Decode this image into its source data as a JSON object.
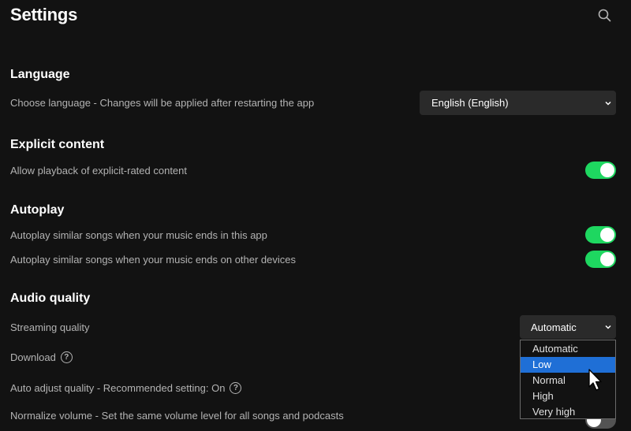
{
  "header": {
    "title": "Settings",
    "search_icon": "search-icon"
  },
  "language": {
    "heading": "Language",
    "label": "Choose language - Changes will be applied after restarting the app",
    "selected": "English (English)"
  },
  "explicit": {
    "heading": "Explicit content",
    "label": "Allow playback of explicit-rated content",
    "enabled": true
  },
  "autoplay": {
    "heading": "Autoplay",
    "this_app_label": "Autoplay similar songs when your music ends in this app",
    "other_devices_label": "Autoplay similar songs when your music ends on other devices"
  },
  "audio_quality": {
    "heading": "Audio quality",
    "streaming_label": "Streaming quality",
    "streaming_selected": "Automatic",
    "download_label": "Download",
    "auto_adjust_label": "Auto adjust quality - Recommended setting: On",
    "normalize_label": "Normalize volume - Set the same volume level for all songs and podcasts",
    "options": [
      "Automatic",
      "Low",
      "Normal",
      "High",
      "Very high"
    ],
    "highlighted_option": "Low"
  },
  "colors": {
    "background": "#121212",
    "accent_green": "#1ed760",
    "select_bg": "#2a2a2a",
    "highlight_blue": "#1f6fd6"
  }
}
